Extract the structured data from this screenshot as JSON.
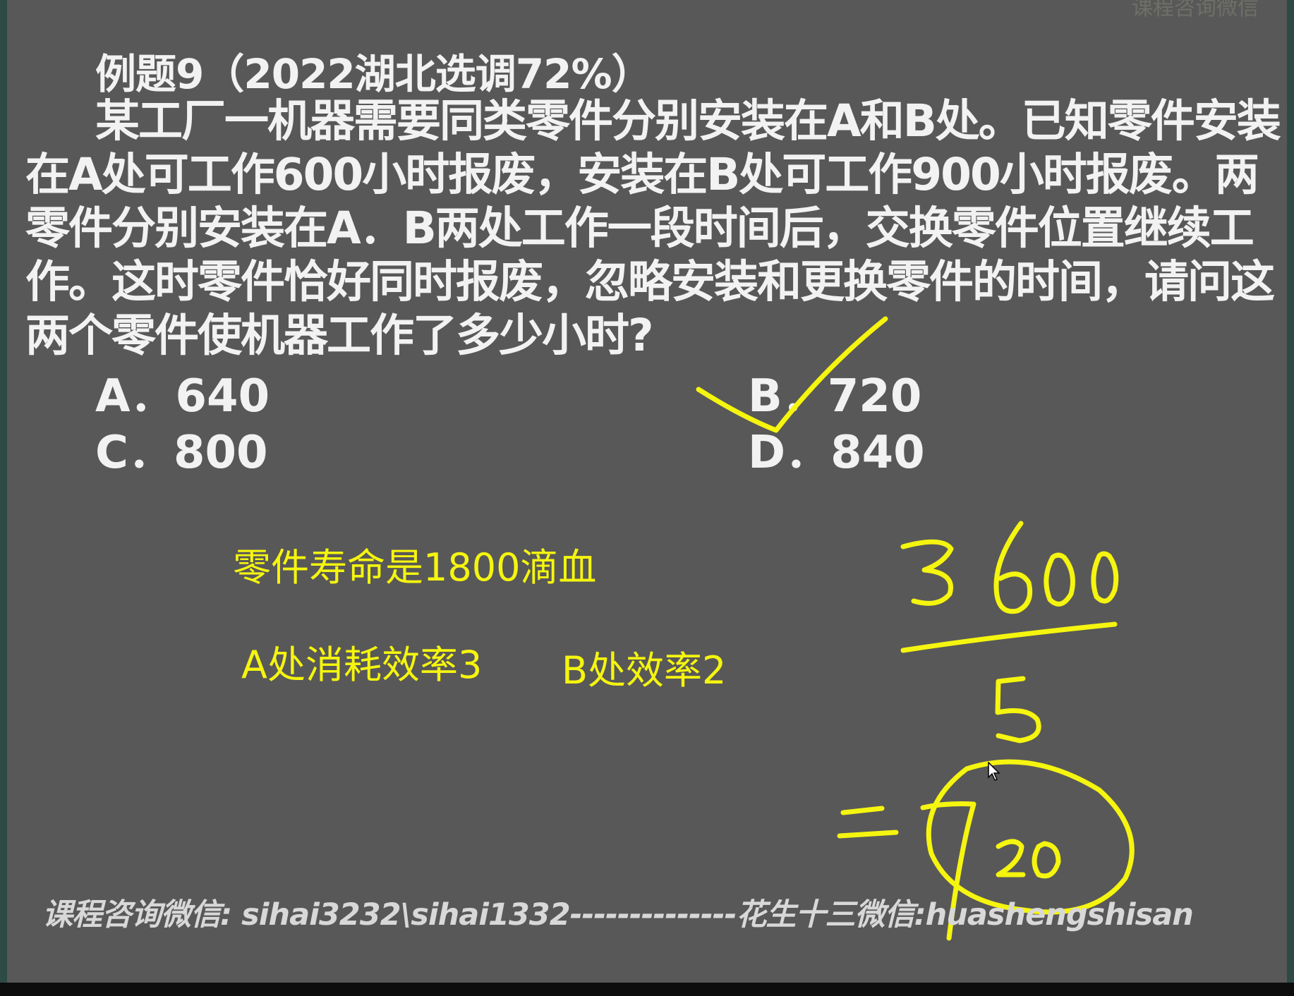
{
  "header": {
    "faint_text": "课程咨询微信"
  },
  "problem": {
    "title": "例题9（2022湖北选调72%）",
    "text": "某工厂一机器需要同类零件分别安装在A和B处。已知零件安装在A处可工作600小时报废，安装在B处可工作900小时报废。两零件分别安装在A．B两处工作一段时间后，交换零件位置继续工作。这时零件恰好同时报废，忽略安装和更换零件的时间，请问这两个零件使机器工作了多少小时?",
    "options": [
      {
        "label": "A．640"
      },
      {
        "label": "B．720"
      },
      {
        "label": "C．800"
      },
      {
        "label": "D．840"
      }
    ],
    "marked_answer": "B"
  },
  "annotations": {
    "life_note": "零件寿命是1800滴血",
    "a_rate_note": "A处消耗效率3",
    "b_rate_note": "B处效率2",
    "numerator": "3600",
    "denominator": "5",
    "result": "=720"
  },
  "footer": {
    "text": "课程咨询微信: sihai3232\\sihai1332--------------花生十三微信:huashengshisan"
  },
  "colors": {
    "slide_bg": "#585858",
    "text": "#f2f2f2",
    "ink": "#f5f50f",
    "side_strip": "#2e4a45"
  }
}
